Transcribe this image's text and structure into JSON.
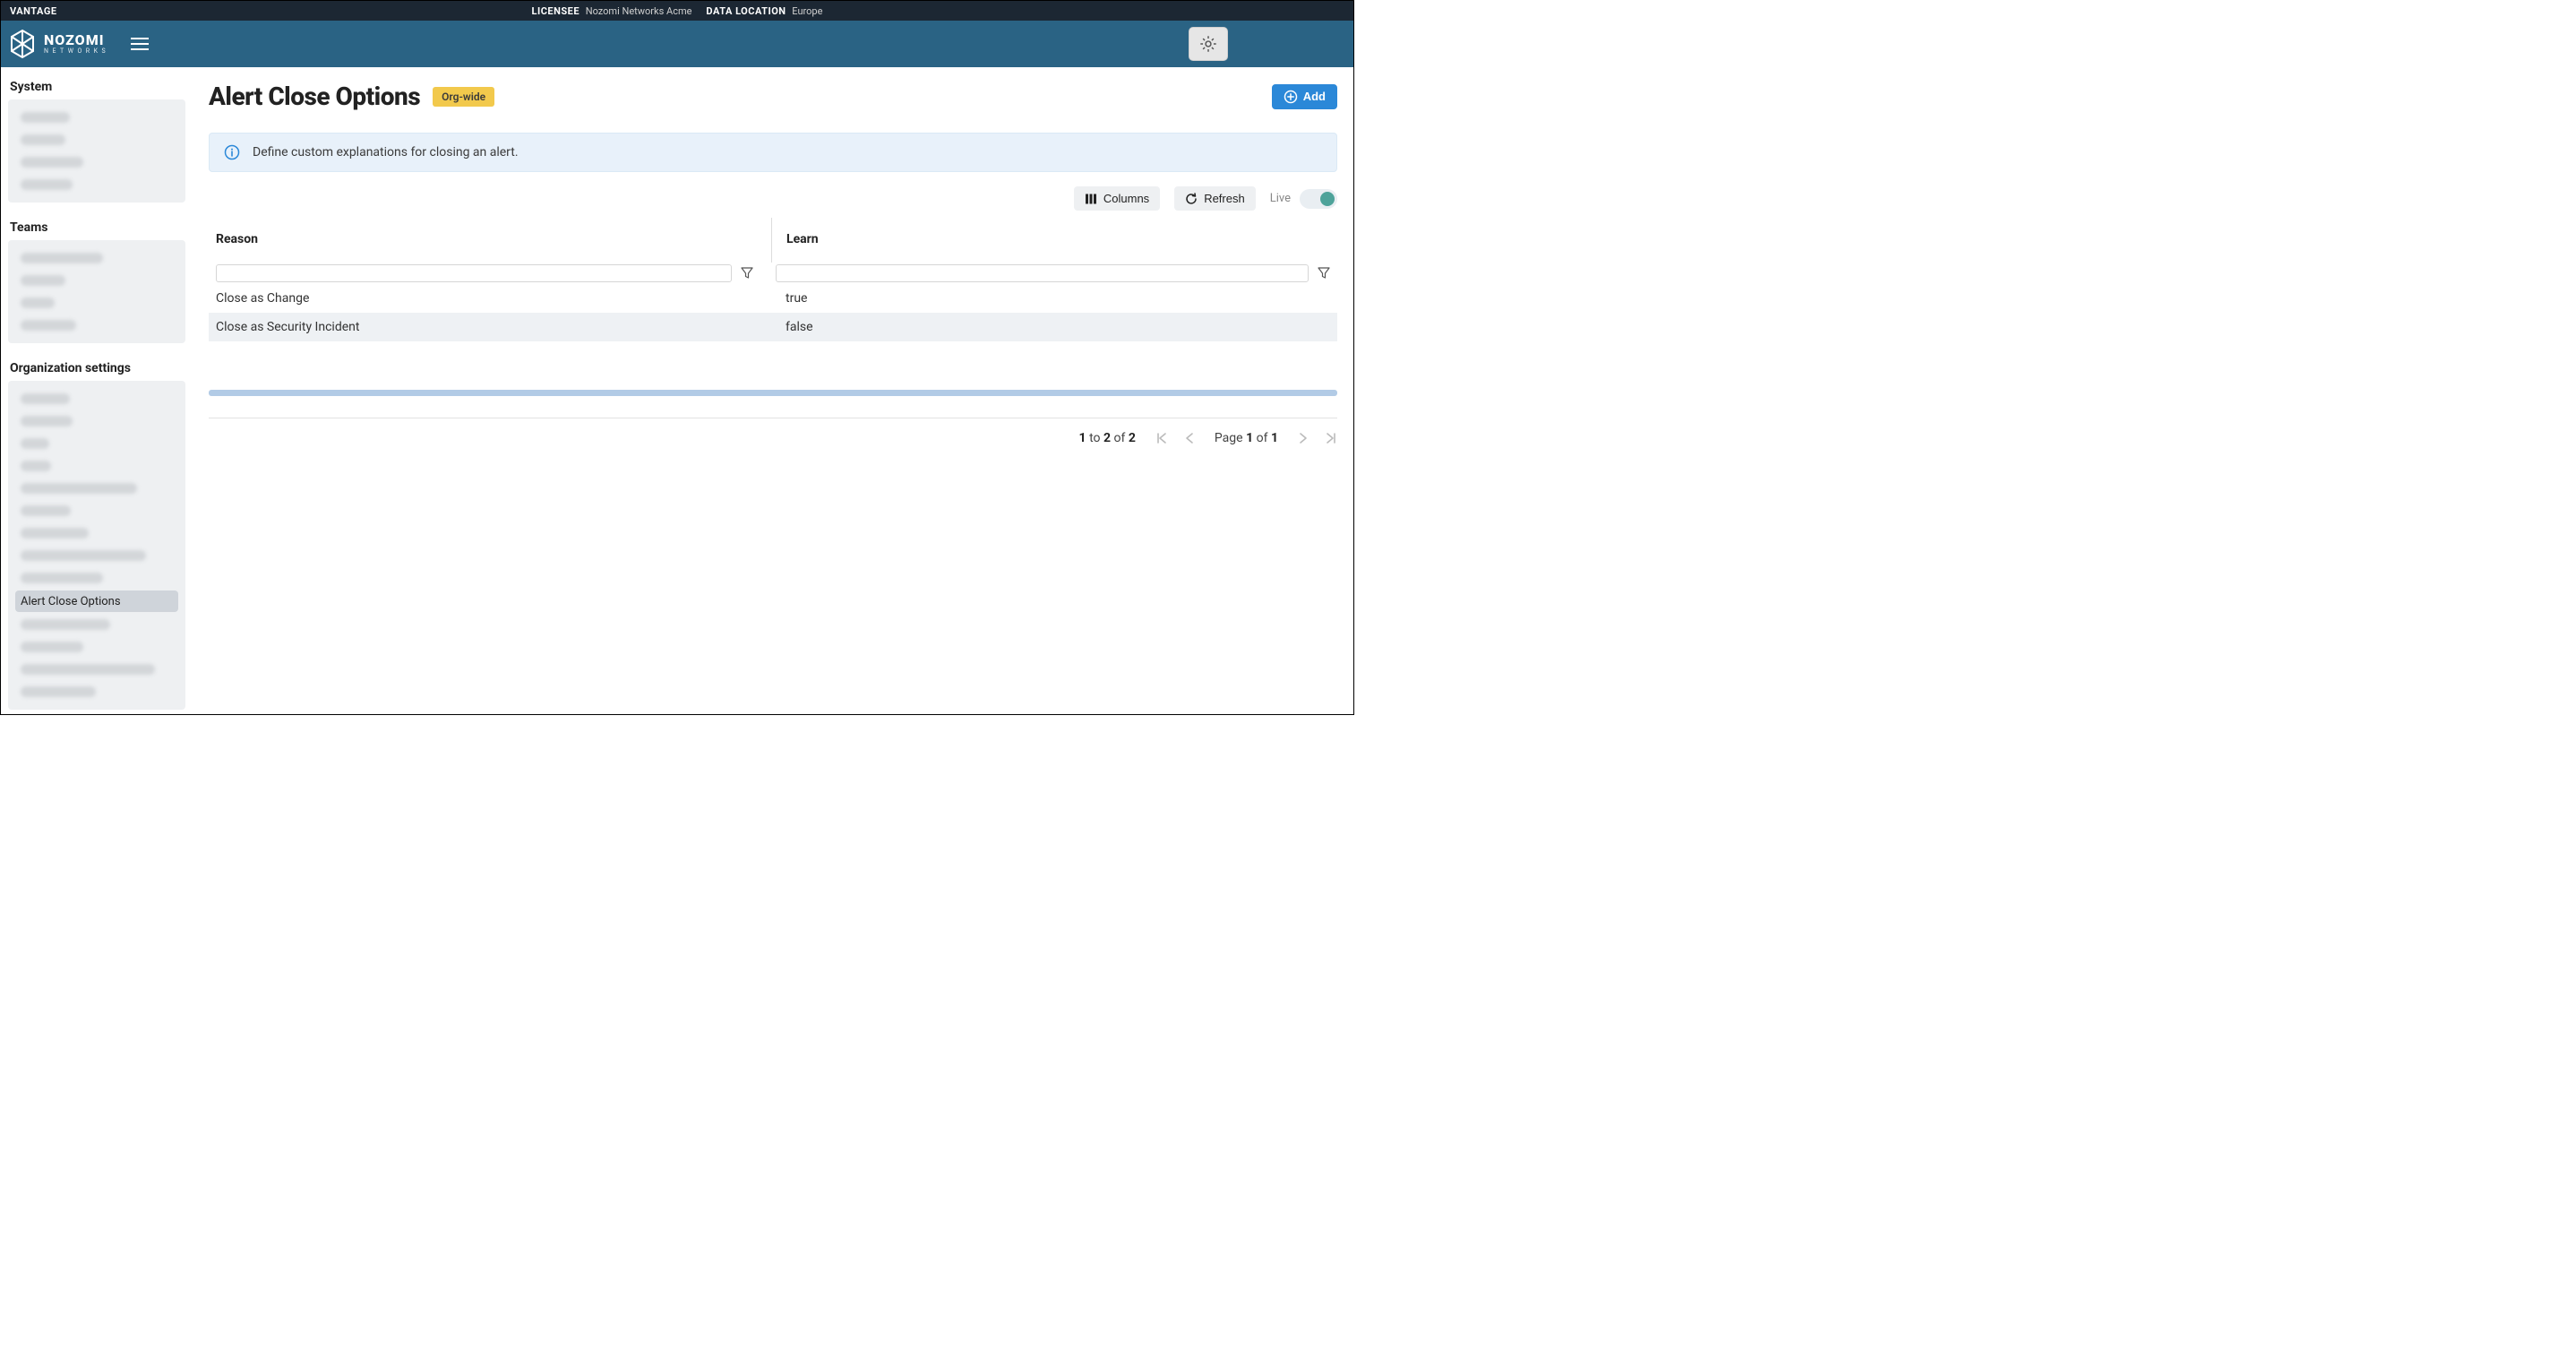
{
  "topbar": {
    "brand": "VANTAGE",
    "licensee_label": "LICENSEE",
    "licensee_value": "Nozomi Networks Acme",
    "data_location_label": "DATA LOCATION",
    "data_location_value": "Europe"
  },
  "logo": {
    "main": "NOZOMI",
    "sub": "NETWORKS"
  },
  "sidebar": {
    "section1_title": "System",
    "section2_title": "Teams",
    "section3_title": "Organization settings",
    "active_item_label": "Alert Close Options"
  },
  "page": {
    "title": "Alert Close Options",
    "scope_badge": "Org-wide",
    "add_button": "Add",
    "info_banner": "Define custom explanations for closing an alert."
  },
  "toolbar": {
    "columns": "Columns",
    "refresh": "Refresh",
    "live": "Live"
  },
  "table": {
    "columns": {
      "reason": "Reason",
      "learn": "Learn"
    },
    "rows": [
      {
        "reason": "Close as Change",
        "learn": "true"
      },
      {
        "reason": "Close as Security Incident",
        "learn": "false"
      }
    ]
  },
  "pagination": {
    "from": "1",
    "to_word": "to",
    "to": "2",
    "of_word": "of",
    "total": "2",
    "page_label": "Page",
    "current": "1",
    "page_of_word": "of",
    "total_pages": "1"
  }
}
